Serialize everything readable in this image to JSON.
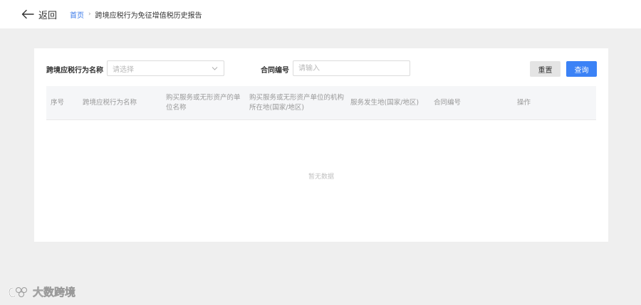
{
  "header": {
    "back_label": "返回",
    "breadcrumb": {
      "home": "首页",
      "separator": "›",
      "current": "跨境应税行为免征增值税历史报告"
    }
  },
  "filters": {
    "name_label": "跨境应税行为名称",
    "name_placeholder": "请选择",
    "contract_label": "合同编号",
    "contract_placeholder": "请输入",
    "reset_label": "重置",
    "query_label": "查询"
  },
  "table": {
    "columns": [
      "序号",
      "跨境应税行为名称",
      "购买服务或无形资产的单位名称",
      "购买服务或无形资产单位的机构所在地(国家/地区)",
      "服务发生地(国家/地区)",
      "合同编号",
      "操作"
    ],
    "empty_text": "暂无数据"
  },
  "watermark": {
    "text": "大数跨境"
  },
  "colors": {
    "primary": "#3b82f6",
    "link": "#3b7ae9",
    "page_bg": "#efefef"
  }
}
